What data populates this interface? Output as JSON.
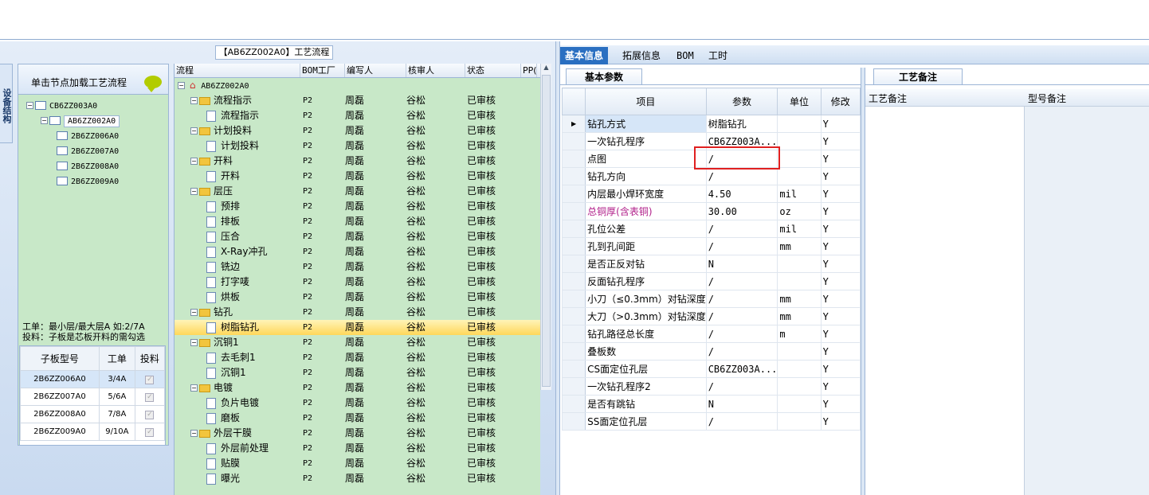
{
  "left_panel": {
    "side_tab": "设备结构",
    "header": "单击节点加载工艺流程",
    "tree": [
      "CB6ZZ003A0",
      "AB6ZZ002A0",
      "2B6ZZ006A0",
      "2B6ZZ007A0",
      "2B6ZZ008A0",
      "2B6ZZ009A0"
    ],
    "info_line1": "工单：最小层/最大层A 如:2/7A",
    "info_line2": "投料：子板是芯板开料的需勾选",
    "sub_table": {
      "headers": [
        "子板型号",
        "工单",
        "投料"
      ],
      "rows": [
        [
          "2B6ZZ006A0",
          "3/4A",
          "✓"
        ],
        [
          "2B6ZZ007A0",
          "5/6A",
          "✓"
        ],
        [
          "2B6ZZ008A0",
          "7/8A",
          "✓"
        ],
        [
          "2B6ZZ009A0",
          "9/10A",
          "✓"
        ]
      ]
    }
  },
  "process_panel": {
    "title": "【AB6ZZ002A0】工艺流程",
    "headers": [
      "流程",
      "BOM工厂",
      "编写人",
      "核审人",
      "状态",
      "PP("
    ],
    "root": "AB6ZZ002A0",
    "rows": [
      {
        "name": "流程指示",
        "level": 1,
        "type": "folder",
        "bom": "P2",
        "writer": "周磊",
        "reviewer": "谷松",
        "status": "已审核"
      },
      {
        "name": "流程指示",
        "level": 2,
        "type": "doc",
        "bom": "P2",
        "writer": "周磊",
        "reviewer": "谷松",
        "status": "已审核"
      },
      {
        "name": "计划投料",
        "level": 1,
        "type": "folder",
        "bom": "P2",
        "writer": "周磊",
        "reviewer": "谷松",
        "status": "已审核"
      },
      {
        "name": "计划投料",
        "level": 2,
        "type": "doc",
        "bom": "P2",
        "writer": "周磊",
        "reviewer": "谷松",
        "status": "已审核"
      },
      {
        "name": "开料",
        "level": 1,
        "type": "folder",
        "bom": "P2",
        "writer": "周磊",
        "reviewer": "谷松",
        "status": "已审核"
      },
      {
        "name": "开料",
        "level": 2,
        "type": "doc",
        "bom": "P2",
        "writer": "周磊",
        "reviewer": "谷松",
        "status": "已审核"
      },
      {
        "name": "层压",
        "level": 1,
        "type": "folder",
        "bom": "P2",
        "writer": "周磊",
        "reviewer": "谷松",
        "status": "已审核"
      },
      {
        "name": "预排",
        "level": 2,
        "type": "doc",
        "bom": "P2",
        "writer": "周磊",
        "reviewer": "谷松",
        "status": "已审核"
      },
      {
        "name": "排板",
        "level": 2,
        "type": "doc",
        "bom": "P2",
        "writer": "周磊",
        "reviewer": "谷松",
        "status": "已审核"
      },
      {
        "name": "压合",
        "level": 2,
        "type": "doc",
        "bom": "P2",
        "writer": "周磊",
        "reviewer": "谷松",
        "status": "已审核"
      },
      {
        "name": "X-Ray冲孔",
        "level": 2,
        "type": "doc",
        "bom": "P2",
        "writer": "周磊",
        "reviewer": "谷松",
        "status": "已审核"
      },
      {
        "name": "铣边",
        "level": 2,
        "type": "doc",
        "bom": "P2",
        "writer": "周磊",
        "reviewer": "谷松",
        "status": "已审核"
      },
      {
        "name": "打字唛",
        "level": 2,
        "type": "doc",
        "bom": "P2",
        "writer": "周磊",
        "reviewer": "谷松",
        "status": "已审核"
      },
      {
        "name": "烘板",
        "level": 2,
        "type": "doc",
        "bom": "P2",
        "writer": "周磊",
        "reviewer": "谷松",
        "status": "已审核"
      },
      {
        "name": "钻孔",
        "level": 1,
        "type": "folder",
        "bom": "P2",
        "writer": "周磊",
        "reviewer": "谷松",
        "status": "已审核"
      },
      {
        "name": "树脂钻孔",
        "level": 2,
        "type": "doc",
        "bom": "P2",
        "writer": "周磊",
        "reviewer": "谷松",
        "status": "已审核",
        "selected": true
      },
      {
        "name": "沉铜1",
        "level": 1,
        "type": "folder",
        "bom": "P2",
        "writer": "周磊",
        "reviewer": "谷松",
        "status": "已审核"
      },
      {
        "name": "去毛刺1",
        "level": 2,
        "type": "doc",
        "bom": "P2",
        "writer": "周磊",
        "reviewer": "谷松",
        "status": "已审核"
      },
      {
        "name": "沉铜1",
        "level": 2,
        "type": "doc",
        "bom": "P2",
        "writer": "周磊",
        "reviewer": "谷松",
        "status": "已审核"
      },
      {
        "name": "电镀",
        "level": 1,
        "type": "folder",
        "bom": "P2",
        "writer": "周磊",
        "reviewer": "谷松",
        "status": "已审核"
      },
      {
        "name": "负片电镀",
        "level": 2,
        "type": "doc",
        "bom": "P2",
        "writer": "周磊",
        "reviewer": "谷松",
        "status": "已审核"
      },
      {
        "name": "磨板",
        "level": 2,
        "type": "doc",
        "bom": "P2",
        "writer": "周磊",
        "reviewer": "谷松",
        "status": "已审核"
      },
      {
        "name": "外层干膜",
        "level": 1,
        "type": "folder",
        "bom": "P2",
        "writer": "周磊",
        "reviewer": "谷松",
        "status": "已审核"
      },
      {
        "name": "外层前处理",
        "level": 2,
        "type": "doc",
        "bom": "P2",
        "writer": "周磊",
        "reviewer": "谷松",
        "status": "已审核"
      },
      {
        "name": "贴膜",
        "level": 2,
        "type": "doc",
        "bom": "P2",
        "writer": "周磊",
        "reviewer": "谷松",
        "status": "已审核"
      },
      {
        "name": "曝光",
        "level": 2,
        "type": "doc",
        "bom": "P2",
        "writer": "周磊",
        "reviewer": "谷松",
        "status": "已审核"
      }
    ]
  },
  "tabs": [
    "基本信息",
    "拓展信息",
    "BOM",
    "工时"
  ],
  "basic_params": {
    "tab": "基本参数",
    "headers": [
      "项目",
      "参数",
      "单位",
      "修改"
    ],
    "rows": [
      [
        "钻孔方式",
        "树脂钻孔",
        "",
        "Y"
      ],
      [
        "一次钻孔程序",
        "CB6ZZ003A...",
        "",
        "Y"
      ],
      [
        "点图",
        "/",
        "",
        "Y"
      ],
      [
        "钻孔方向",
        "/",
        "",
        "Y"
      ],
      [
        "内层最小焊环宽度",
        "4.50",
        "mil",
        "Y"
      ],
      [
        "总铜厚(含表铜)",
        "30.00",
        "oz",
        "Y"
      ],
      [
        "孔位公差",
        "/",
        "mil",
        "Y"
      ],
      [
        "孔到孔间距",
        "/",
        "mm",
        "Y"
      ],
      [
        "是否正反对钻",
        "N",
        "",
        "Y"
      ],
      [
        "反面钻孔程序",
        "/",
        "",
        "Y"
      ],
      [
        "小刀（≤0.3mm）对钻深度",
        "/",
        "mm",
        "Y"
      ],
      [
        "大刀（>0.3mm）对钻深度",
        "/",
        "mm",
        "Y"
      ],
      [
        "钻孔路径总长度",
        "/",
        "m",
        "Y"
      ],
      [
        "叠板数",
        "/",
        "",
        "Y"
      ],
      [
        "CS面定位孔层",
        "CB6ZZ003A...",
        "",
        "Y"
      ],
      [
        "一次钻孔程序2",
        "/",
        "",
        "Y"
      ],
      [
        "是否有跳钻",
        "N",
        "",
        "Y"
      ],
      [
        "SS面定位孔层",
        "/",
        "",
        "Y"
      ]
    ]
  },
  "remarks": {
    "tab": "工艺备注",
    "col1": "工艺备注",
    "col2": "型号备注"
  },
  "colors": {
    "tree_bg": "#c8e8c8",
    "accent": "#2a6fc1",
    "highlight": "#b01f8a",
    "alert": "#e02020"
  }
}
